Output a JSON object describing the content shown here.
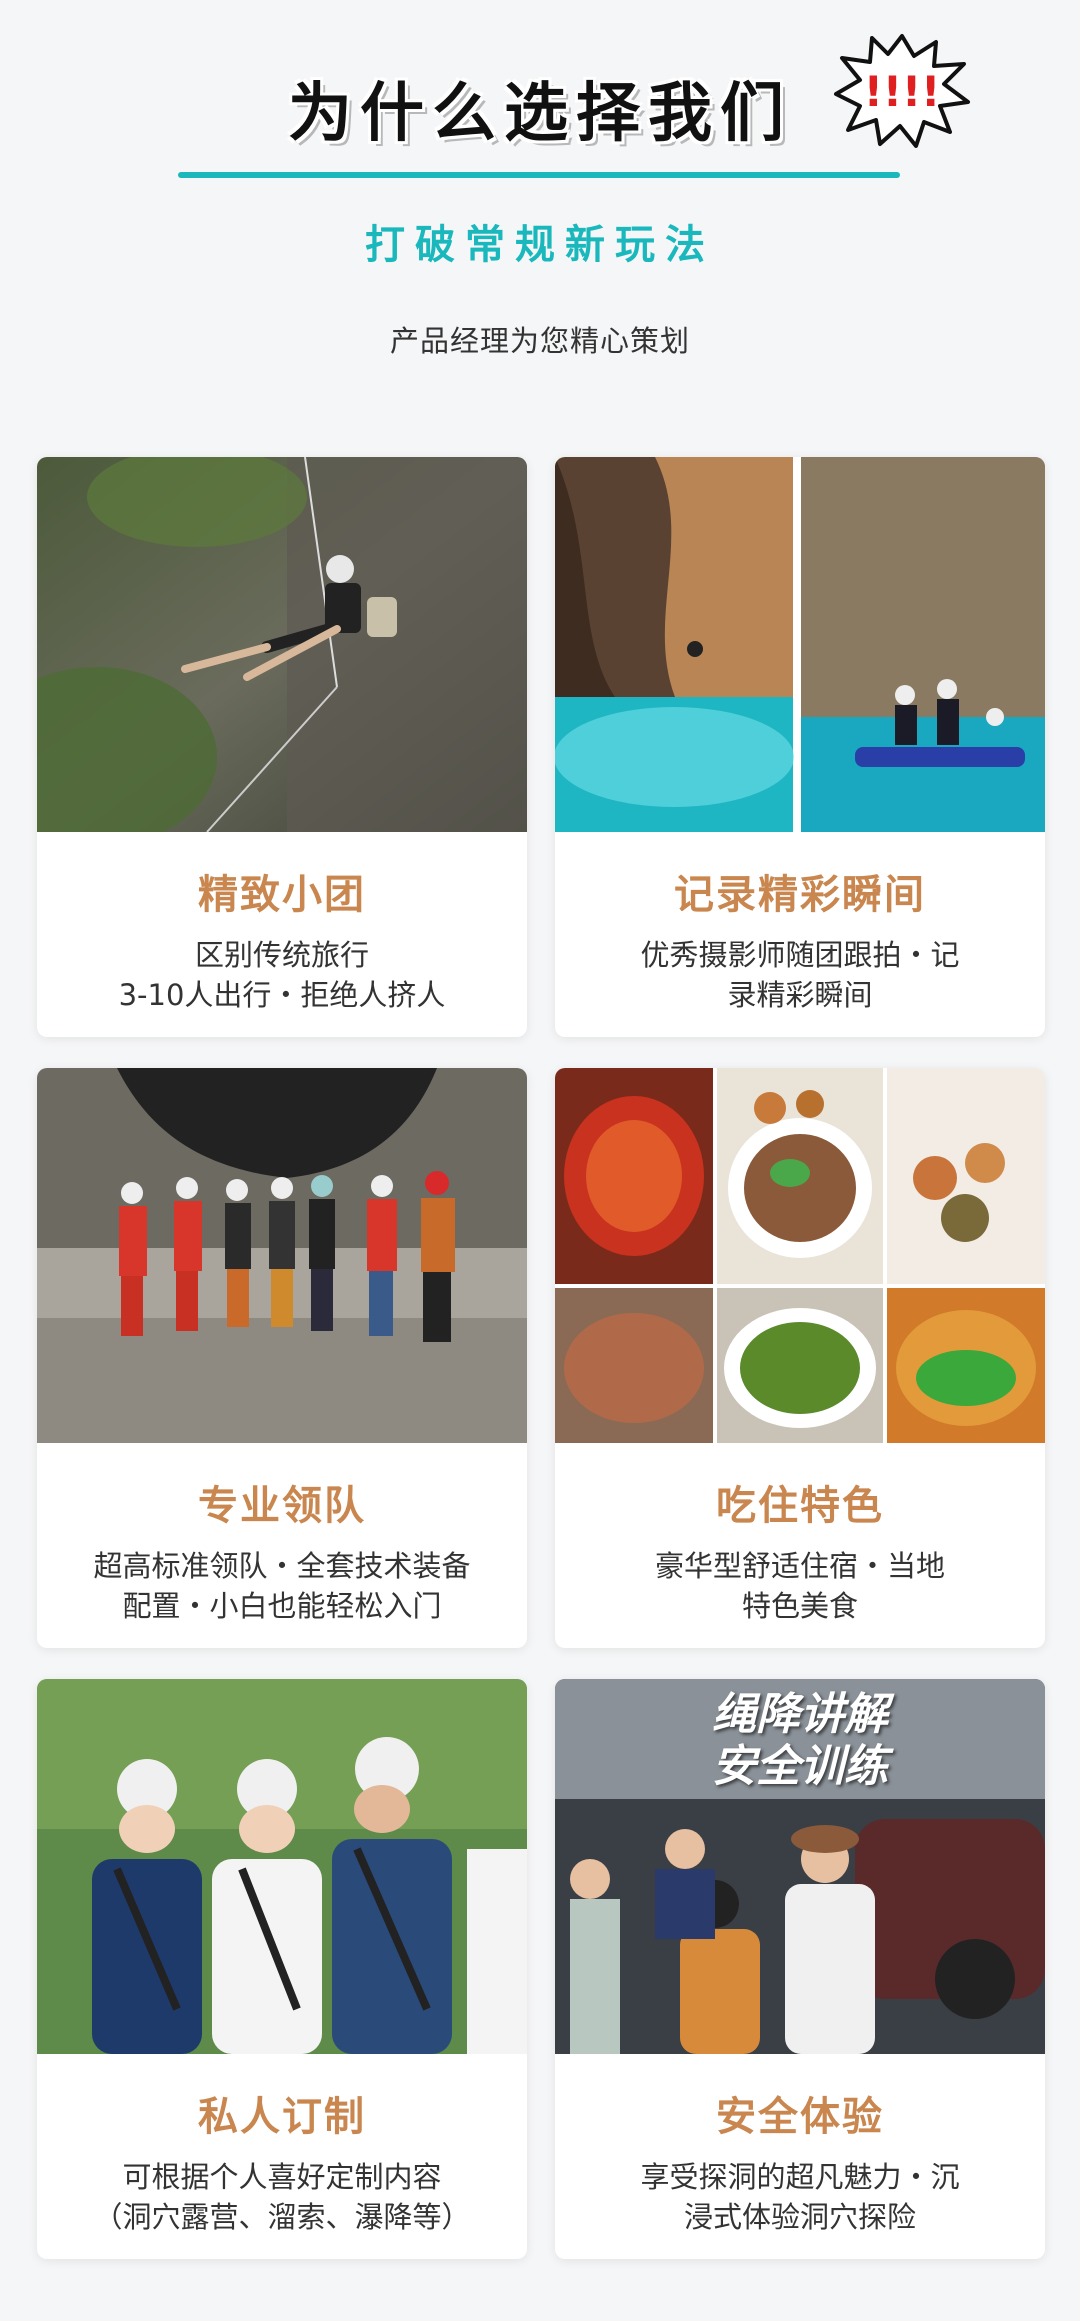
{
  "header": {
    "title": "为什么选择我们",
    "burst_text": "!!!!",
    "subtitle": "打破常规新玩法",
    "tagline": "产品经理为您精心策划"
  },
  "cards": [
    {
      "title": "精致小团",
      "desc_lines": [
        "区别传统旅行",
        "3-10人出行・拒绝人挤人"
      ],
      "photo": "rappelling-cliff"
    },
    {
      "title": "记录精彩瞬间",
      "desc_lines": [
        "优秀摄影师随团跟拍・记",
        "录精彩瞬间"
      ],
      "photo": "cave-water-kayak"
    },
    {
      "title": "专业领队",
      "desc_lines": [
        "超高标准领队・全套技术装备",
        "配置・小白也能轻松入门"
      ],
      "photo": "team-in-cave"
    },
    {
      "title": "吃住特色",
      "desc_lines": [
        "豪华型舒适住宿・当地",
        "特色美食"
      ],
      "photo": "local-food-collage"
    },
    {
      "title": "私人订制",
      "desc_lines": [
        "可根据个人喜好定制内容",
        "（洞穴露营、溜索、瀑降等）"
      ],
      "photo": "harness-training"
    },
    {
      "title": "安全体验",
      "desc_lines": [
        "享受探洞的超凡魅力・沉",
        "浸式体验洞穴探险"
      ],
      "photo": "rope-safety-training",
      "photo_caption": [
        "绳降讲解",
        "安全训练"
      ]
    }
  ],
  "colors": {
    "accent_teal": "#1ab8bd",
    "card_title": "#c9874f",
    "background": "#f5f6f7"
  }
}
